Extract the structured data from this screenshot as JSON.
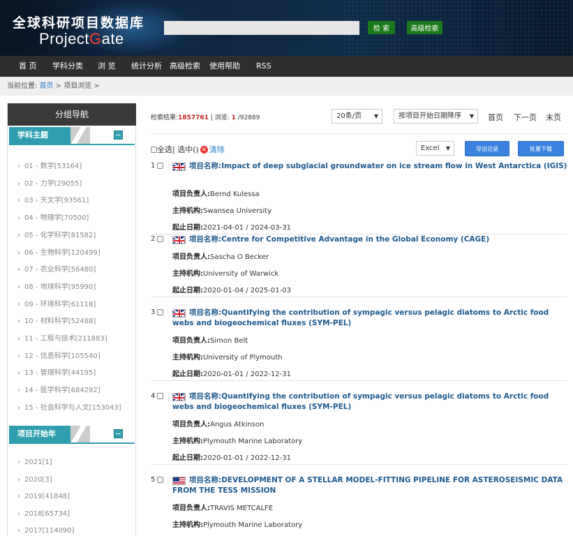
{
  "header": {
    "logo_cn": "全球科研项目数据库",
    "logo_en_a": "Project",
    "logo_en_g": "G",
    "logo_en_b": "ate",
    "search_placeholder": "",
    "search_button": "检 索",
    "advanced_button": "高级检索"
  },
  "nav": [
    "首 页",
    "学科分类",
    "浏 览",
    "统计分析",
    "高级检索",
    "使用帮助",
    "RSS"
  ],
  "breadcrumb": {
    "prefix": "当前位置:",
    "home": "首页",
    "sep1": " > ",
    "current": "项目浏览",
    "sep2": " >"
  },
  "sidebar": {
    "title": "分组导航",
    "subject_section": "学科主题",
    "subjects": [
      "01 - 数学[53164]",
      "02 - 力学[29055]",
      "03 - 天文学[93561]",
      "04 - 物理学[70500]",
      "05 - 化学科学[81582]",
      "06 - 生物科学[120499]",
      "07 - 农业科学[56480]",
      "08 - 地球科学[95990]",
      "09 - 环境科学[61118]",
      "10 - 材料科学[52488]",
      "11 - 工程与技术[211883]",
      "12 - 信息科学[105540]",
      "13 - 管理科学[44195]",
      "14 - 医学科学[684292]",
      "15 - 社会科学与人文[153043]"
    ],
    "year_section": "项目开始年",
    "years": [
      "2021[1]",
      "2020[3]",
      "2019[41848]",
      "2018[65734]",
      "2017[114090]"
    ],
    "collapse_symbol": "−",
    "bullet": "›"
  },
  "results": {
    "label_total": "检索结果:",
    "total": "1857761",
    "label_browse": " | 浏览:",
    "page": "1",
    "pages": " /92889",
    "per_page": "20条/页",
    "sort": "按项目开始日期降序",
    "first": "首页",
    "next": "下一页",
    "last": "末页",
    "select_all": "全选",
    "selected": " | 选中()",
    "clear": "清除",
    "export_format": "Excel",
    "export_btn": "导出记录",
    "batch_btn": "批量下载",
    "dropdown_arrow": "▼"
  },
  "labels": {
    "title": "项目名称:",
    "leader": "项目负责人:",
    "org": "主持机构:",
    "dates": "起止日期:"
  },
  "records": [
    {
      "num": "1",
      "flag": "uk",
      "title": "Impact of deep subglacial groundwater on ice stream flow in West Antarctica (IGIS)",
      "leader": "Bernd Kulessa",
      "org": "Swansea University",
      "dates": "2021-04-01 / 2024-03-31"
    },
    {
      "num": "2",
      "flag": "uk",
      "title": "Centre for Competitive Advantage in the Global Economy (CAGE)",
      "leader": "Sascha O Becker",
      "org": "University of Warwick",
      "dates": "2020-01-04 / 2025-01-03"
    },
    {
      "num": "3",
      "flag": "uk",
      "title": "Quantifying the contribution of sympagic versus pelagic diatoms to Arctic food webs and biogeochemical fluxes (SYM-PEL)",
      "leader": "Simon Belt",
      "org": "University of Plymouth",
      "dates": "2020-01-01 / 2022-12-31"
    },
    {
      "num": "4",
      "flag": "uk",
      "title": "Quantifying the contribution of sympagic versus pelagic diatoms to Arctic food webs and biogeochemical fluxes (SYM-PEL)",
      "leader": "Angus Atkinson",
      "org": "Plymouth Marine Laboratory",
      "dates": "2020-01-01 / 2022-12-31"
    },
    {
      "num": "5",
      "flag": "us",
      "title": "DEVELOPMENT OF A STELLAR MODEL-FITTING PIPELINE FOR ASTEROSEISMIC DATA FROM THE TESS MISSION",
      "leader": "TRAVIS METCALFE",
      "org": "Plymouth Marine Laboratory",
      "dates": ""
    }
  ]
}
